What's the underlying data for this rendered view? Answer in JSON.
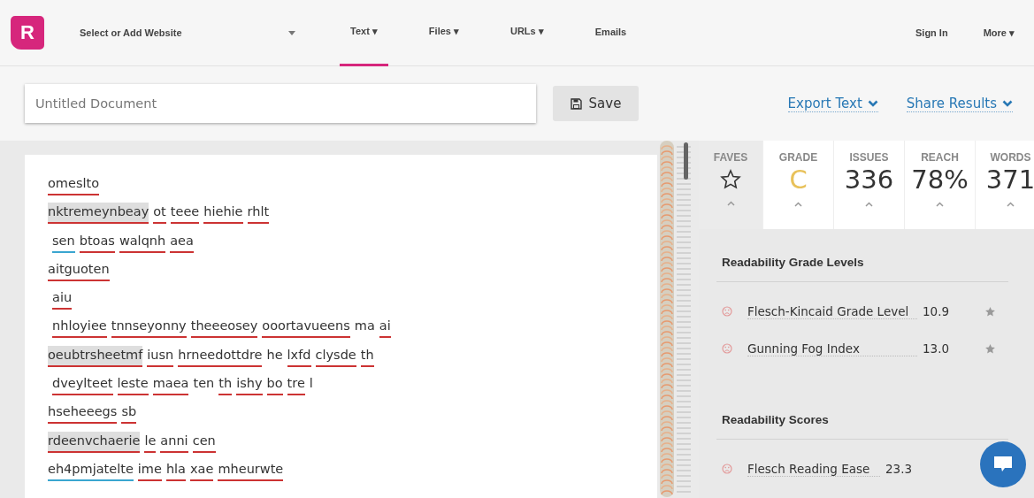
{
  "nav": {
    "logo": "R",
    "website_select": "Select or Add Website",
    "tabs": [
      {
        "label": "Text ▾",
        "selected": true
      },
      {
        "label": "Files ▾",
        "selected": false
      },
      {
        "label": "URLs ▾",
        "selected": false
      },
      {
        "label": "Emails",
        "selected": false
      }
    ],
    "right": [
      "Sign In",
      "More ▾"
    ]
  },
  "toolbar": {
    "title_placeholder": "Untitled Document",
    "save": "Save",
    "export": "Export Text",
    "share": "Share Results"
  },
  "document": {
    "lines": [
      {
        "indent": false,
        "words": [
          {
            "text": "omeslto",
            "color": "#cc3333",
            "highlighted": false
          }
        ]
      },
      {
        "indent": false,
        "words": [
          {
            "text": "nktremeynbeay",
            "color": "#cc3333",
            "highlighted": true
          },
          {
            "text": "ot",
            "color": "#cc3333",
            "highlighted": false
          },
          {
            "text": "teee",
            "color": "#cc3333",
            "highlighted": false
          },
          {
            "text": "hiehie",
            "color": "#cc3333",
            "highlighted": false
          },
          {
            "text": "rhlt",
            "color": "#cc3333",
            "highlighted": false
          }
        ]
      },
      {
        "indent": true,
        "words": [
          {
            "text": "sen",
            "color": "#3aa6d0",
            "highlighted": false
          },
          {
            "text": "btoas",
            "color": "#cc3333",
            "highlighted": false
          },
          {
            "text": "walqnh",
            "color": "#cc3333",
            "highlighted": false
          },
          {
            "text": "aea",
            "color": "#cc3333",
            "highlighted": false
          }
        ]
      },
      {
        "indent": false,
        "words": [
          {
            "text": "aitguoten",
            "color": "#cc3333",
            "highlighted": false
          }
        ]
      },
      {
        "indent": true,
        "words": [
          {
            "text": "aiu",
            "color": "#cc3333",
            "highlighted": false
          }
        ]
      },
      {
        "indent": true,
        "words": [
          {
            "text": "nhloyiee",
            "color": "#cc3333",
            "highlighted": false
          },
          {
            "text": "tnnseyonny",
            "color": "#cc3333",
            "highlighted": false
          },
          {
            "text": "theeeosey",
            "color": "#cc3333",
            "highlighted": false
          },
          {
            "text": "ooortavueens",
            "color": "#cc3333",
            "highlighted": false
          },
          {
            "text": "ma",
            "highlighted": false
          },
          {
            "text": "ai",
            "color": "#cc3333",
            "highlighted": false
          }
        ]
      },
      {
        "indent": false,
        "words": [
          {
            "text": "oeubtrsheetmf",
            "color": "#cc3333",
            "highlighted": true
          },
          {
            "text": "iusn",
            "color": "#cc3333",
            "highlighted": false
          },
          {
            "text": "hrneedottdre",
            "color": "#cc3333",
            "highlighted": false
          },
          {
            "text": "he",
            "highlighted": false
          },
          {
            "text": "lxfd",
            "color": "#cc3333",
            "highlighted": false
          },
          {
            "text": "clysde",
            "color": "#cc3333",
            "highlighted": false
          },
          {
            "text": "th",
            "color": "#cc3333",
            "highlighted": false
          }
        ]
      },
      {
        "indent": true,
        "words": [
          {
            "text": "dveylteet",
            "color": "#cc3333",
            "highlighted": false
          },
          {
            "text": "leste",
            "color": "#cc3333",
            "highlighted": false
          },
          {
            "text": "maea",
            "color": "#cc3333",
            "highlighted": false
          },
          {
            "text": "ten",
            "highlighted": false
          },
          {
            "text": "th",
            "color": "#cc3333",
            "highlighted": false
          },
          {
            "text": "ishy",
            "color": "#cc3333",
            "highlighted": false
          },
          {
            "text": "bo",
            "color": "#cc3333",
            "highlighted": false
          },
          {
            "text": "tre",
            "color": "#cc3333",
            "highlighted": false
          },
          {
            "text": "l",
            "highlighted": false
          }
        ]
      },
      {
        "indent": false,
        "words": [
          {
            "text": "hseheeegs",
            "color": "#cc3333",
            "highlighted": false
          },
          {
            "text": "sb",
            "color": "#cc3333",
            "highlighted": false
          }
        ]
      },
      {
        "indent": false,
        "words": [
          {
            "text": "rdeenvchaerie",
            "color": "#cc3333",
            "highlighted": true
          },
          {
            "text": "le",
            "color": "#cc3333",
            "highlighted": false
          },
          {
            "text": "anni",
            "color": "#cc3333",
            "highlighted": false
          },
          {
            "text": "cen",
            "color": "#cc3333",
            "highlighted": false
          }
        ]
      },
      {
        "indent": false,
        "words": [
          {
            "text": "eh4pmjatelte",
            "color": "#3aa6d0",
            "highlighted": false
          },
          {
            "text": "ime",
            "color": "#cc3333",
            "highlighted": false
          },
          {
            "text": "hla",
            "color": "#cc3333",
            "highlighted": false
          },
          {
            "text": "xae",
            "color": "#cc3333",
            "highlighted": false
          },
          {
            "text": "mheurwte",
            "color": "#cc3333",
            "highlighted": false
          }
        ]
      }
    ]
  },
  "stats": [
    {
      "kind": "star",
      "label": "FAVES",
      "selected": false
    },
    {
      "kind": "value",
      "label": "GRADE",
      "value": "C",
      "color": "#e8c15a",
      "selected": true
    },
    {
      "kind": "value",
      "label": "ISSUES",
      "value": "336",
      "color": "#333333",
      "selected": true
    },
    {
      "kind": "value",
      "label": "REACH",
      "value": "78%",
      "color": "#333333",
      "selected": true
    },
    {
      "kind": "value",
      "label": "WORDS",
      "value": "371",
      "color": "#333333",
      "selected": true
    }
  ],
  "sections": [
    {
      "title": "Readability Grade Levels",
      "metrics": [
        {
          "name": "Flesch-Kincaid Grade Level",
          "value": "10.9",
          "pinned": true
        },
        {
          "name": "Gunning Fog Index",
          "value": "13.0",
          "pinned": true
        }
      ]
    },
    {
      "title": "Readability Scores",
      "metrics": [
        {
          "name": "Flesch Reading Ease",
          "value": "23.3"
        }
      ]
    }
  ]
}
